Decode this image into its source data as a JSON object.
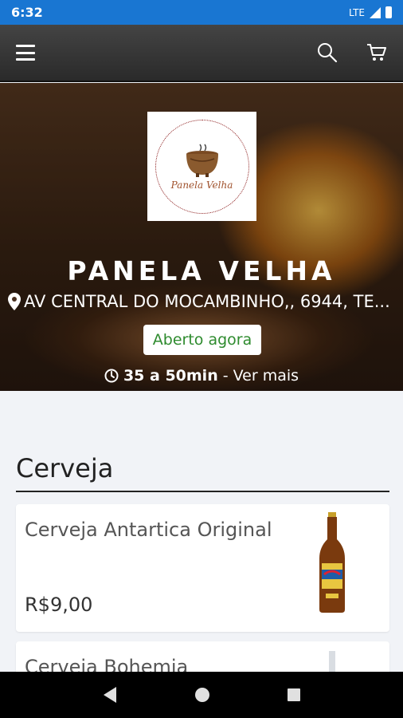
{
  "status_bar": {
    "time": "6:32",
    "network": "LTE"
  },
  "app_bar": {
    "menu_icon": "hamburger-menu-icon",
    "search_icon": "search-icon",
    "cart_icon": "cart-icon"
  },
  "store": {
    "logo_text": "Panela Velha",
    "name": "PANELA VELHA",
    "address": "AV CENTRAL DO MOCAMBINHO,, 6944, TE...",
    "status": "Aberto agora",
    "delivery_time": "35 a 50min",
    "more_link": "- Ver mais"
  },
  "section": {
    "title": "Cerveja",
    "products": [
      {
        "name": "Cerveja Antartica Original",
        "price": "R$9,00"
      },
      {
        "name": "Cerveja Bohemia",
        "price": ""
      }
    ]
  },
  "colors": {
    "status_bar": "#1976d2",
    "open_badge_text": "#2e8b2e",
    "app_bar": "#333333"
  }
}
